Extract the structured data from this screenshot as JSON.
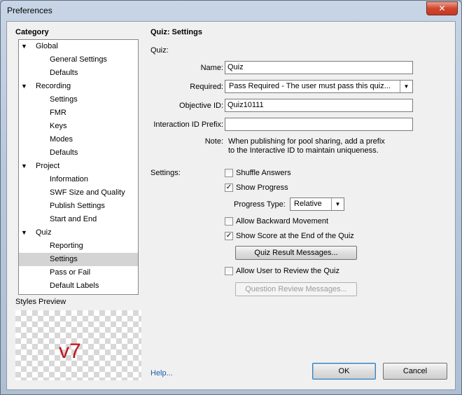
{
  "window": {
    "title": "Preferences",
    "close_label": "✕"
  },
  "sidebar": {
    "category_label": "Category",
    "tree": [
      {
        "label": "Global",
        "level": 0,
        "expanded": true
      },
      {
        "label": "General Settings",
        "level": 1
      },
      {
        "label": "Defaults",
        "level": 1
      },
      {
        "label": "Recording",
        "level": 0,
        "expanded": true
      },
      {
        "label": "Settings",
        "level": 1
      },
      {
        "label": "FMR",
        "level": 1
      },
      {
        "label": "Keys",
        "level": 1
      },
      {
        "label": "Modes",
        "level": 1
      },
      {
        "label": "Defaults",
        "level": 1
      },
      {
        "label": "Project",
        "level": 0,
        "expanded": true
      },
      {
        "label": "Information",
        "level": 1
      },
      {
        "label": "SWF Size and Quality",
        "level": 1
      },
      {
        "label": "Publish Settings",
        "level": 1
      },
      {
        "label": "Start and End",
        "level": 1
      },
      {
        "label": "Quiz",
        "level": 0,
        "expanded": true
      },
      {
        "label": "Reporting",
        "level": 1
      },
      {
        "label": "Settings",
        "level": 1,
        "selected": true
      },
      {
        "label": "Pass or Fail",
        "level": 1
      },
      {
        "label": "Default Labels",
        "level": 1
      }
    ],
    "styles_preview_label": "Styles Preview",
    "preview_text": "v7"
  },
  "main": {
    "title": "Quiz: Settings",
    "quiz_section_label": "Quiz:",
    "name_label": "Name:",
    "name_value": "Quiz",
    "required_label": "Required:",
    "required_value": "Pass Required - The user must pass this quiz...",
    "objective_label": "Objective ID:",
    "objective_value": "Quiz10111",
    "interaction_label": "Interaction ID Prefix:",
    "interaction_value": "",
    "note_label": "Note:",
    "note_line1": "When publishing for pool sharing, add a prefix",
    "note_line2": "to the Interactive ID to maintain uniqueness.",
    "settings_label": "Settings:",
    "shuffle_label": "Shuffle Answers",
    "shuffle_checked": false,
    "show_progress_label": "Show Progress",
    "show_progress_checked": true,
    "progress_type_label": "Progress Type:",
    "progress_type_value": "Relative",
    "backward_label": "Allow Backward Movement",
    "backward_checked": false,
    "show_score_label": "Show Score at the End of the Quiz",
    "show_score_checked": true,
    "result_messages_label": "Quiz Result Messages...",
    "review_label": "Allow User to Review the Quiz",
    "review_checked": false,
    "review_messages_label": "Question Review Messages..."
  },
  "footer": {
    "help_label": "Help...",
    "ok_label": "OK",
    "cancel_label": "Cancel"
  },
  "colors": {
    "preview_text": "#c0141b",
    "link": "#1a5dae",
    "selected_row": "#d4d4d4"
  }
}
